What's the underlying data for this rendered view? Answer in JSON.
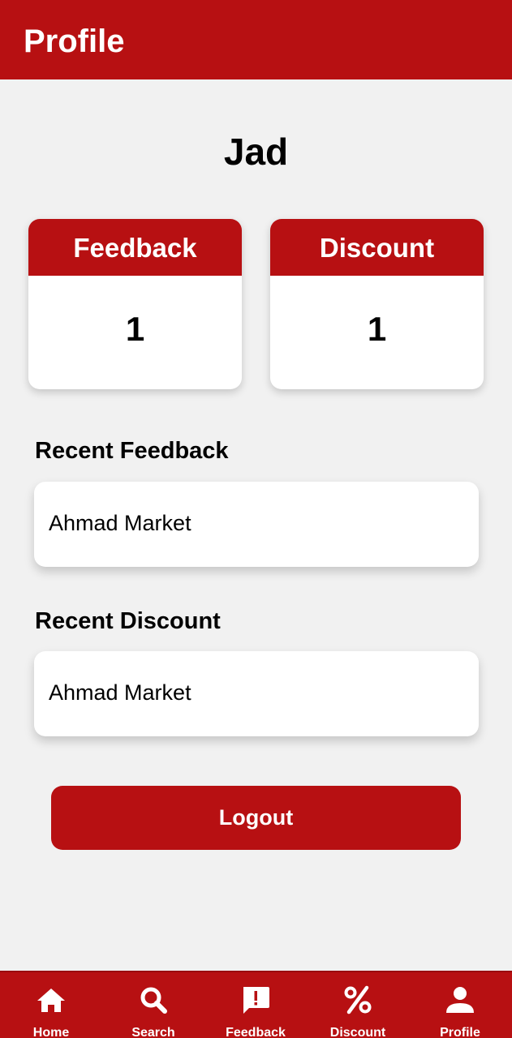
{
  "appbar": {
    "title": "Profile"
  },
  "user": {
    "name": "Jad"
  },
  "stats": {
    "feedback": {
      "label": "Feedback",
      "value": "1"
    },
    "discount": {
      "label": "Discount",
      "value": "1"
    }
  },
  "recent_feedback": {
    "title": "Recent Feedback",
    "item": "Ahmad Market"
  },
  "recent_discount": {
    "title": "Recent Discount",
    "item": "Ahmad Market"
  },
  "logout": {
    "label": "Logout"
  },
  "nav": {
    "items": [
      {
        "label": "Home",
        "icon": "home-icon"
      },
      {
        "label": "Search",
        "icon": "search-icon"
      },
      {
        "label": "Feedback",
        "icon": "feedback-icon"
      },
      {
        "label": "Discount",
        "icon": "percent-icon"
      },
      {
        "label": "Profile",
        "icon": "person-icon"
      }
    ]
  },
  "colors": {
    "brand": "#b71012",
    "background": "#f1f1f1",
    "card": "#ffffff"
  }
}
